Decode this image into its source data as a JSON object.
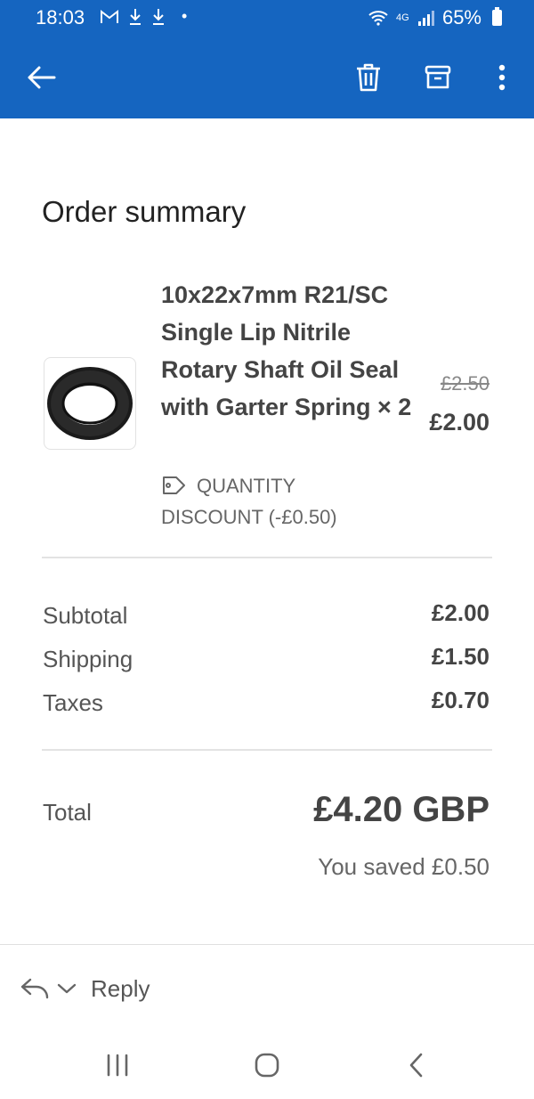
{
  "status_bar": {
    "time": "18:03",
    "network": "4G",
    "battery": "65%"
  },
  "toolbar": {
    "back_icon": "arrow-left-icon",
    "delete_icon": "trash-icon",
    "archive_icon": "archive-icon",
    "more_icon": "more-vertical-icon"
  },
  "order": {
    "heading": "Order summary",
    "item": {
      "title": "10x22x7mm R21/SC Single Lip Nitrile Rotary Shaft Oil Seal with Garter Spring × 2",
      "discount_label": "QUANTITY DISCOUNT (-£0.50)",
      "original_price": "£2.50",
      "price": "£2.00"
    },
    "summary": {
      "subtotal_label": "Subtotal",
      "subtotal_value": "£2.00",
      "shipping_label": "Shipping",
      "shipping_value": "£1.50",
      "taxes_label": "Taxes",
      "taxes_value": "£0.70"
    },
    "total_label": "Total",
    "total_value": "£4.20 GBP",
    "saved_text": "You saved £0.50"
  },
  "reply": {
    "label": "Reply"
  },
  "colors": {
    "appbar": "#1565c0",
    "text": "#444444"
  }
}
